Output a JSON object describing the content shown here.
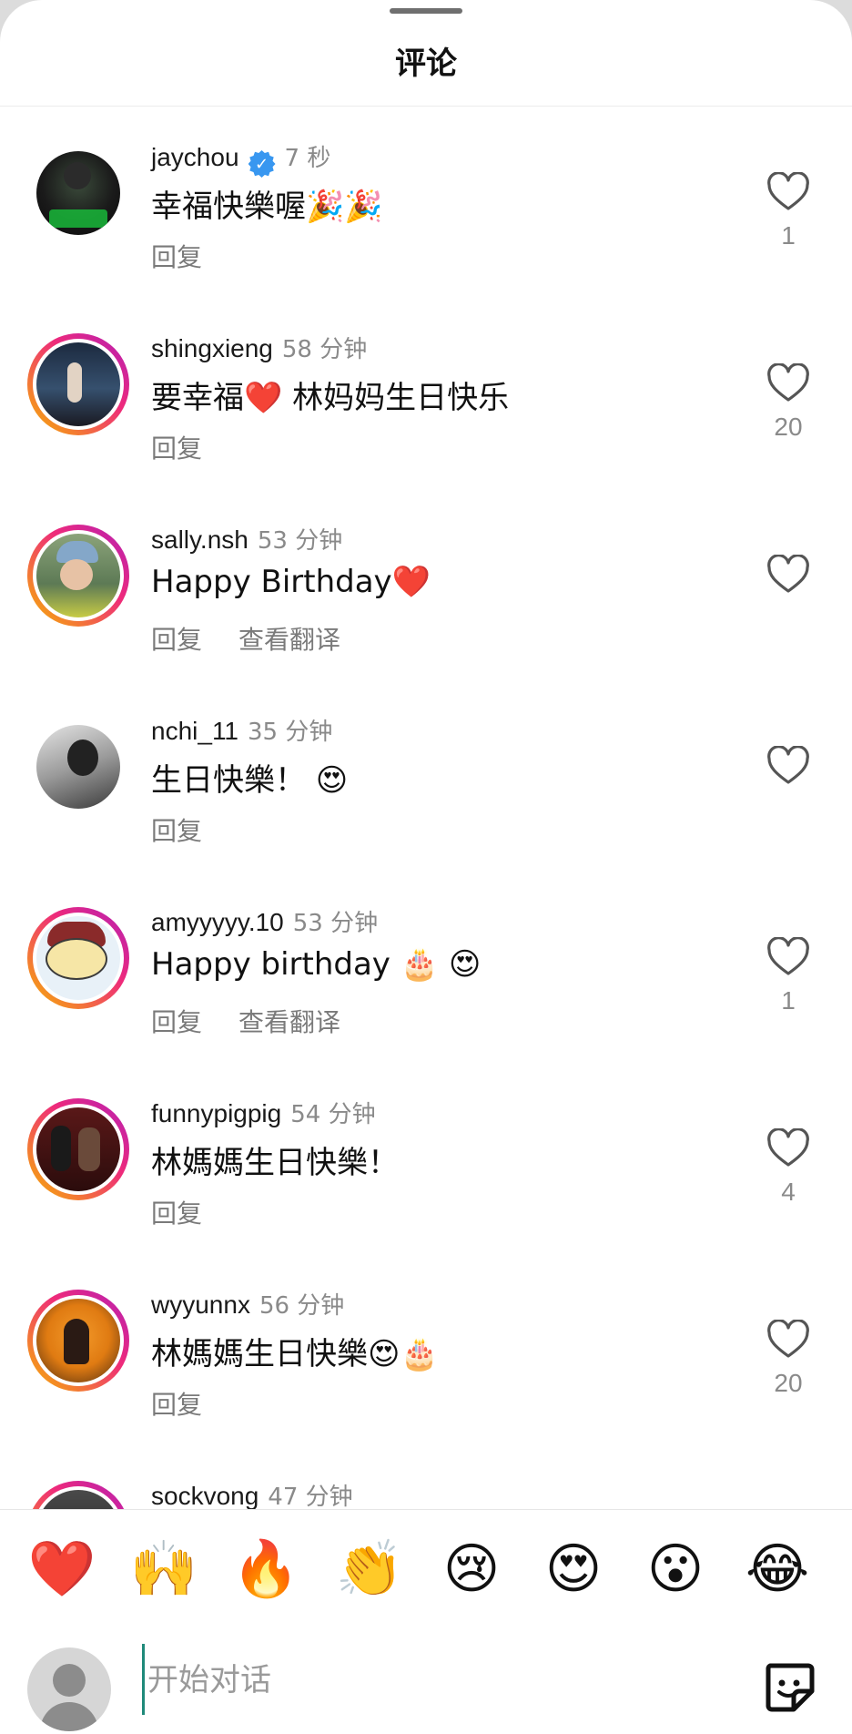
{
  "sheet": {
    "title": "评论"
  },
  "comments": [
    {
      "username": "jaycho u",
      "verified": true,
      "time": "7 秒",
      "text": "幸福快樂喔🎉🎉",
      "reply_label": "回复",
      "translate_label": "",
      "likes": "1",
      "avatar_style": "plain",
      "avatar_class": "av-jay"
    },
    {
      "username": "shingxieng",
      "verified": false,
      "time": "58 分钟",
      "text": "要幸福❤️ 林妈妈生日快乐",
      "reply_label": "回复",
      "translate_label": "",
      "likes": "20",
      "avatar_style": "story",
      "avatar_class": "av-shing"
    },
    {
      "username": "sally.nsh",
      "verified": false,
      "time": "53 分钟",
      "text": "Happy Birthday❤️",
      "reply_label": "回复",
      "translate_label": "查看翻译",
      "likes": "",
      "avatar_style": "story",
      "avatar_class": "av-sally"
    },
    {
      "username": "nchi_11",
      "verified": false,
      "time": "35 分钟",
      "text": "生日快樂！ 😍",
      "reply_label": "回复",
      "translate_label": "",
      "likes": "",
      "avatar_style": "plain",
      "avatar_class": "av-nchi"
    },
    {
      "username": "amyyyyy.10",
      "verified": false,
      "time": "53 分钟",
      "text": "Happy birthday 🎂 😍",
      "reply_label": "回复",
      "translate_label": "查看翻译",
      "likes": "1",
      "avatar_style": "story",
      "avatar_class": "av-amy"
    },
    {
      "username": "funnypigpig",
      "verified": false,
      "time": "54 分钟",
      "text": "林媽媽生日快樂！",
      "reply_label": "回复",
      "translate_label": "",
      "likes": "4",
      "avatar_style": "story",
      "avatar_class": "av-funny"
    },
    {
      "username": "wyyunnx",
      "verified": false,
      "time": "56 分钟",
      "text": "林媽媽生日快樂😍🎂",
      "reply_label": "回复",
      "translate_label": "",
      "likes": "20",
      "avatar_style": "story",
      "avatar_class": "av-wyy"
    },
    {
      "username": "sockvong",
      "verified": false,
      "time": "47 分钟",
      "text": "",
      "reply_label": "",
      "translate_label": "",
      "likes": "",
      "avatar_style": "story",
      "avatar_class": "av-sock"
    }
  ],
  "reactions": [
    {
      "emoji": "❤️",
      "name": "heart",
      "has_variants": false
    },
    {
      "emoji": "🙌",
      "name": "raised-hands",
      "has_variants": true
    },
    {
      "emoji": "🔥",
      "name": "fire",
      "has_variants": false
    },
    {
      "emoji": "👏",
      "name": "clapping-hands",
      "has_variants": true
    },
    {
      "emoji": "😢",
      "name": "crying-face",
      "has_variants": false
    },
    {
      "emoji": "😍",
      "name": "heart-eyes",
      "has_variants": false
    },
    {
      "emoji": "😮",
      "name": "surprised-face",
      "has_variants": false
    },
    {
      "emoji": "😂",
      "name": "tears-of-joy",
      "has_variants": false
    }
  ],
  "composer": {
    "placeholder": "开始对话"
  }
}
